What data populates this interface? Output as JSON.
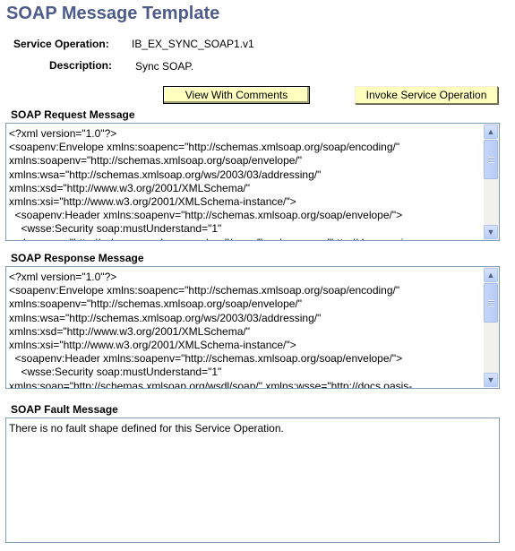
{
  "page": {
    "title": "SOAP Message Template"
  },
  "fields": {
    "service_operation_label": "Service Operation:",
    "service_operation_value": "IB_EX_SYNC_SOAP1.v1",
    "description_label": "Description:",
    "description_value": "Sync SOAP."
  },
  "toolbar": {
    "view_comments_label": "View With Comments",
    "invoke_label": "Invoke Service Operation"
  },
  "request": {
    "label": "SOAP Request Message",
    "content": "<?xml version=\"1.0\"?>\n<soapenv:Envelope xmlns:soapenc=\"http://schemas.xmlsoap.org/soap/encoding/\"\nxmlns:soapenv=\"http://schemas.xmlsoap.org/soap/envelope/\"\nxmlns:wsa=\"http://schemas.xmlsoap.org/ws/2003/03/addressing/\"\nxmlns:xsd=\"http://www.w3.org/2001/XMLSchema/\"\nxmlns:xsi=\"http://www.w3.org/2001/XMLSchema-instance/\">\n  <soapenv:Header xmlns:soapenv=\"http://schemas.xmlsoap.org/soap/envelope/\">\n    <wsse:Security soap:mustUnderstand=\"1\"\nxmlns:soap=\"http://schemas.xmlsoap.org/wsdl/soap/\" xmlns:wsse=\"http://docs.oasis-"
  },
  "response": {
    "label": "SOAP Response Message",
    "content": "<?xml version=\"1.0\"?>\n<soapenv:Envelope xmlns:soapenc=\"http://schemas.xmlsoap.org/soap/encoding/\"\nxmlns:soapenv=\"http://schemas.xmlsoap.org/soap/envelope/\"\nxmlns:wsa=\"http://schemas.xmlsoap.org/ws/2003/03/addressing/\"\nxmlns:xsd=\"http://www.w3.org/2001/XMLSchema/\"\nxmlns:xsi=\"http://www.w3.org/2001/XMLSchema-instance/\">\n  <soapenv:Header xmlns:soapenv=\"http://schemas.xmlsoap.org/soap/envelope/\">\n    <wsse:Security soap:mustUnderstand=\"1\"\nxmlns:soap=\"http://schemas.xmlsoap.org/wsdl/soap/\" xmlns:wsse=\"http://docs.oasis-"
  },
  "fault": {
    "label": "SOAP Fault Message",
    "content": "There is no fault shape defined for this Service Operation."
  },
  "colors": {
    "title": "#4d5c8a",
    "button_bg": "#ffffc0",
    "textbox_border": "#7f9db9"
  }
}
